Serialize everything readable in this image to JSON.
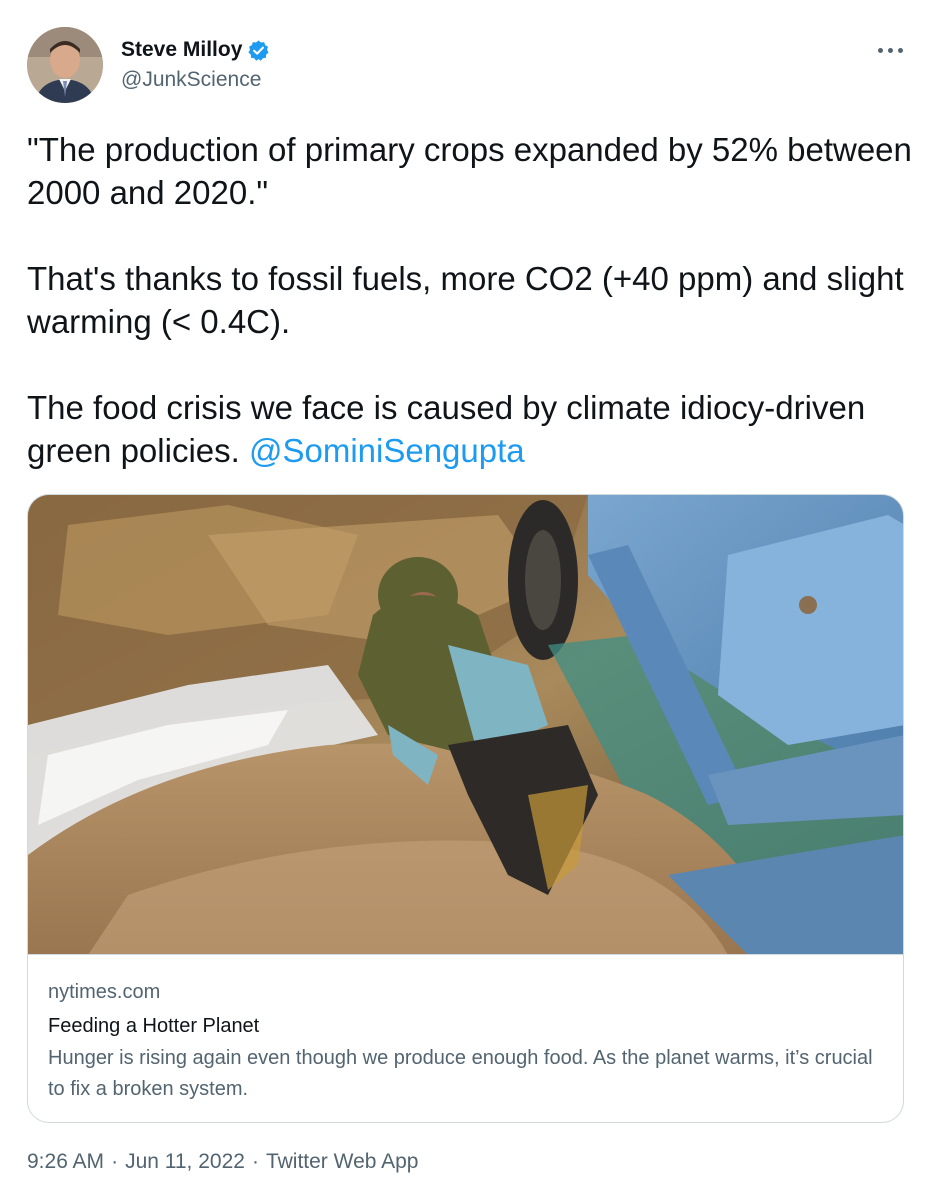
{
  "author": {
    "display_name": "Steve Milloy",
    "handle": "@JunkScience",
    "verified": true,
    "verified_color": "#1d9bf0"
  },
  "tweet": {
    "paragraphs": [
      "\"The production of primary crops expanded by 52% between 2000 and 2020.\"",
      "That's thanks to fossil fuels, more CO2 (+40 ppm) and slight warming (< 0.4C).",
      "The food crisis we face is caused by climate idiocy-driven green policies. "
    ],
    "mention": "@SominiSengupta"
  },
  "card": {
    "domain": "nytimes.com",
    "title": "Feeding a Hotter Planet",
    "description": "Hunger is rising again even though we produce enough food. As the planet warms, it’s crucial to fix a broken system."
  },
  "footer": {
    "time": "9:26 AM",
    "separator": "·",
    "date": "Jun 11, 2022",
    "source": "Twitter Web App"
  },
  "icons": {
    "more": "more-horizontal-icon",
    "verified": "verified-badge-icon"
  },
  "colors": {
    "text": "#0f1419",
    "secondary": "#536471",
    "link": "#1d9bf0",
    "border": "#cfd9de"
  }
}
